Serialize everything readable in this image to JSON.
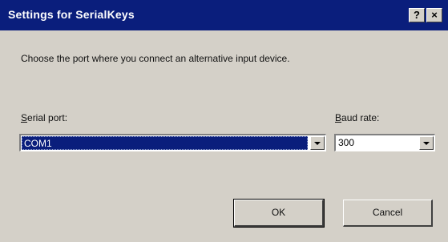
{
  "window": {
    "title": "Settings for SerialKeys",
    "help_label": "?",
    "close_label": "×"
  },
  "instruction": "Choose the port where you connect an alternative input device.",
  "serial_port": {
    "label_accel": "S",
    "label_rest": "erial port:",
    "value": "COM1"
  },
  "baud_rate": {
    "label_accel": "B",
    "label_rest": "aud rate:",
    "value": "300"
  },
  "buttons": {
    "ok": "OK",
    "cancel": "Cancel"
  },
  "colors": {
    "titlebar": "#0a1e7c",
    "face": "#d4d0c8",
    "selection": "#0a1e7c"
  },
  "icons": {
    "dropdown": "chevron-down-icon"
  }
}
